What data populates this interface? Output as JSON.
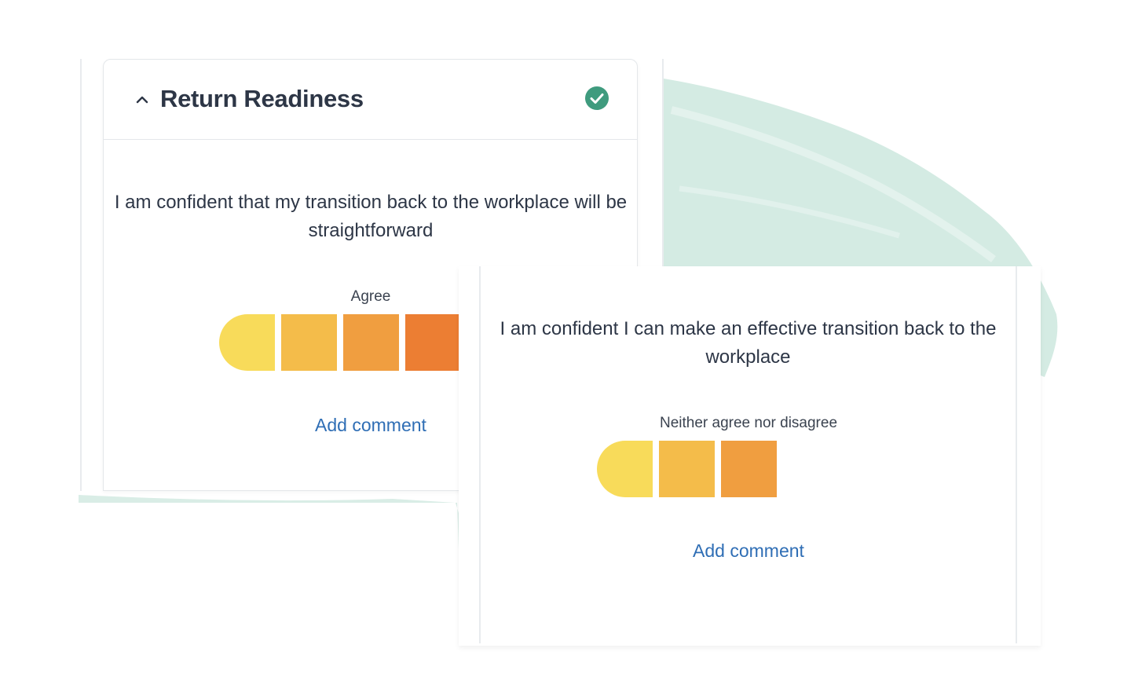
{
  "section": {
    "title": "Return Readiness"
  },
  "card1": {
    "question": "I am confident that my transition back to the workplace will be straightforward",
    "scale_label": "Agree",
    "add_comment": "Add comment",
    "segment_colors": [
      "#f8db5a",
      "#f4bc4a",
      "#f09e40",
      "#ec7e33"
    ]
  },
  "card2": {
    "question": "I am confident I can make an effective transition back to the workplace",
    "scale_label": "Neither agree nor disagree",
    "add_comment": "Add comment",
    "segment_colors": [
      "#f8db5a",
      "#f4bc4a",
      "#f09e40"
    ]
  },
  "colors": {
    "title": "#2d3646",
    "link": "#2f6eb5",
    "check": "#3f9b7e",
    "brush": "#cfe8e0"
  },
  "icons": {
    "collapse": "chevron-up-icon",
    "status": "check-circle-icon"
  }
}
